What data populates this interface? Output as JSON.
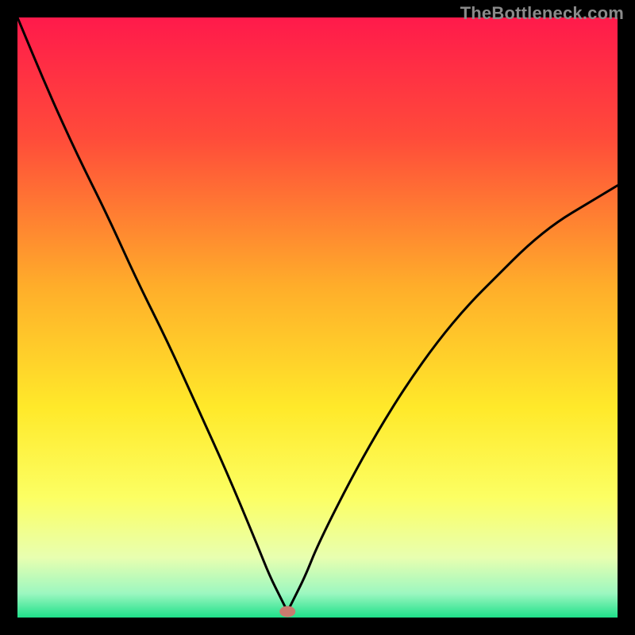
{
  "watermark": "TheBottleneck.com",
  "chart_data": {
    "type": "line",
    "title": "",
    "xlabel": "",
    "ylabel": "",
    "xlim": [
      0,
      100
    ],
    "ylim": [
      0,
      100
    ],
    "x": [
      0,
      5,
      10,
      15,
      20,
      25,
      30,
      35,
      40,
      42,
      44,
      45,
      46,
      48,
      50,
      55,
      60,
      65,
      70,
      75,
      80,
      85,
      90,
      95,
      100
    ],
    "values": [
      100,
      88,
      77,
      67,
      56,
      46,
      35,
      24,
      12,
      7,
      3,
      1,
      3,
      7,
      12,
      22,
      31,
      39,
      46,
      52,
      57,
      62,
      66,
      69,
      72
    ],
    "optimum_x": 45,
    "gradient_stops": [
      {
        "offset": 0.0,
        "color": "#ff1a4b"
      },
      {
        "offset": 0.2,
        "color": "#ff4b3a"
      },
      {
        "offset": 0.45,
        "color": "#ffae2a"
      },
      {
        "offset": 0.65,
        "color": "#ffe92a"
      },
      {
        "offset": 0.8,
        "color": "#fcff63"
      },
      {
        "offset": 0.9,
        "color": "#e8ffb0"
      },
      {
        "offset": 0.96,
        "color": "#9cf7c0"
      },
      {
        "offset": 1.0,
        "color": "#1fe08a"
      }
    ],
    "marker": {
      "x": 45,
      "y": 1,
      "color": "#c97b6f"
    }
  }
}
